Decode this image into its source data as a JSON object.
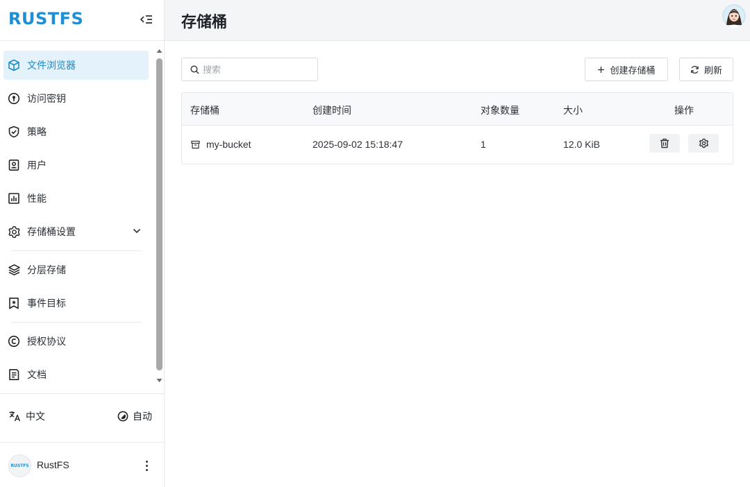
{
  "brand": {
    "logo_text": "RUSTFS",
    "logo_color": "#1e8fd5"
  },
  "sidebar": {
    "items": [
      {
        "label": "文件浏览器",
        "icon": "cube-icon",
        "active": true
      },
      {
        "label": "访问密钥",
        "icon": "key-icon"
      },
      {
        "label": "策略",
        "icon": "shield-icon"
      },
      {
        "label": "用户",
        "icon": "user-card-icon"
      },
      {
        "label": "性能",
        "icon": "bar-chart-icon"
      },
      {
        "label": "存储桶设置",
        "icon": "gear-icon",
        "expandable": true
      },
      {
        "label": "分层存储",
        "icon": "layers-icon"
      },
      {
        "label": "事件目标",
        "icon": "bookmark-star-icon"
      },
      {
        "label": "授权协议",
        "icon": "copyright-icon"
      },
      {
        "label": "文档",
        "icon": "document-icon"
      }
    ],
    "active_color": "#1a8bc8",
    "active_bg": "#e3f2fb"
  },
  "footer": {
    "language": "中文",
    "theme": "自动",
    "user_name": "RustFS",
    "user_avatar_text": "RUSTFS"
  },
  "header": {
    "title": "存储桶"
  },
  "toolbar": {
    "search_placeholder": "搜索",
    "create_label": "创建存储桶",
    "refresh_label": "刷新"
  },
  "table": {
    "columns": [
      "存储桶",
      "创建时间",
      "对象数量",
      "大小",
      "操作"
    ],
    "rows": [
      {
        "name": "my-bucket",
        "created": "2025-09-02 15:18:47",
        "objects": "1",
        "size": "12.0 KiB"
      }
    ]
  }
}
